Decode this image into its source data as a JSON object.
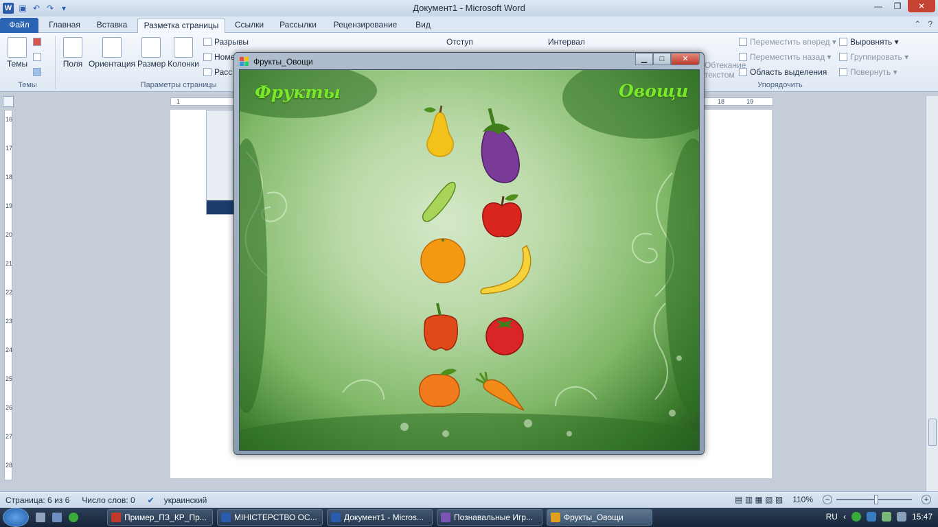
{
  "word": {
    "window_title": "Документ1 - Microsoft Word",
    "tabs": [
      "Файл",
      "Главная",
      "Вставка",
      "Разметка страницы",
      "Ссылки",
      "Рассылки",
      "Рецензирование",
      "Вид"
    ],
    "ribbon": {
      "themes": "Темы",
      "fields": "Поля",
      "orientation": "Ориентация",
      "size": "Размер",
      "columns": "Колонки",
      "breaks": "Разрывы",
      "line_numbers": "Номе",
      "hyphenation": "Расс",
      "indent": "Отступ",
      "spacing": "Интервал",
      "wrap1": "Обтекание",
      "wrap2": "текстом",
      "bring_forward": "Переместить вперед",
      "send_backward": "Переместить назад",
      "selection_pane": "Область выделения",
      "align": "Выровнять",
      "group": "Группировать",
      "rotate": "Повернуть",
      "group_themes": "Темы",
      "group_page_setup": "Параметры страницы",
      "group_arrange": "Упорядочить"
    },
    "ruler_h": [
      "1",
      "18",
      "19"
    ],
    "ruler_v": [
      "16",
      "17",
      "18",
      "19",
      "20",
      "21",
      "22",
      "23",
      "24",
      "25",
      "26",
      "27",
      "28"
    ],
    "status": {
      "page": "Страница: 6 из 6",
      "words": "Число слов: 0",
      "language": "украинский",
      "zoom": "110%"
    }
  },
  "dialog": {
    "title": "Фрукты_Овощи",
    "left_label": "Фрукты",
    "right_label": "Овощи",
    "items": [
      "pear",
      "eggplant",
      "cucumber",
      "apple",
      "orange",
      "banana",
      "bell-pepper",
      "tomato",
      "peach",
      "carrot"
    ]
  },
  "taskbar": {
    "tasks": [
      "Пример_ПЗ_КР_Пр...",
      "МІНІСТЕРСТВО ОС...",
      "Документ1 - Micros...",
      "Познавальные Игр...",
      "Фрукты_Овощи"
    ],
    "lang": "RU",
    "time": "15:47"
  }
}
